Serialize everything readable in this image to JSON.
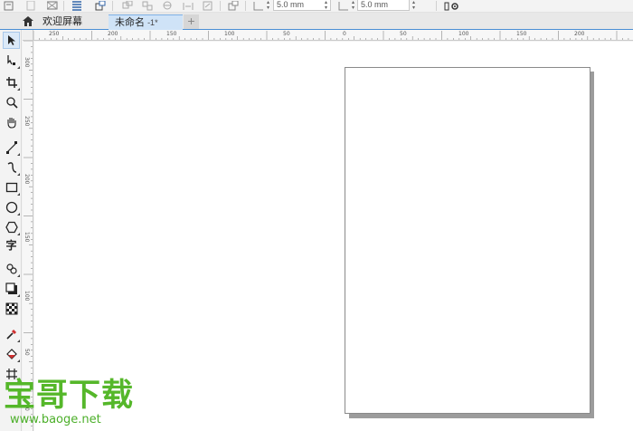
{
  "property_bar": {
    "nudge_x_value": "5.0 mm",
    "nudge_y_value": "5.0 mm"
  },
  "tabs": {
    "welcome_label": "欢迎屏幕",
    "document_label": "未命名",
    "document_suffix": "-1*",
    "add_tab_symbol": "+"
  },
  "toolbox": {
    "text_tool_glyph": "字",
    "items": [
      {
        "name": "pick-tool",
        "icon": "arrow-cursor-icon"
      },
      {
        "name": "shape-tool",
        "icon": "shape-node-icon"
      },
      {
        "name": "crop-tool",
        "icon": "crop-icon"
      },
      {
        "name": "zoom-tool",
        "icon": "magnifier-icon"
      },
      {
        "name": "pan-tool",
        "icon": "hand-icon"
      },
      {
        "name": "freehand-tool",
        "icon": "freehand-line-icon"
      },
      {
        "name": "artistic-media-tool",
        "icon": "curve-icon"
      },
      {
        "name": "rectangle-tool",
        "icon": "rectangle-icon"
      },
      {
        "name": "ellipse-tool",
        "icon": "ellipse-icon"
      },
      {
        "name": "polygon-tool",
        "icon": "polygon-icon"
      },
      {
        "name": "text-tool",
        "icon": "text-icon"
      },
      {
        "name": "parallel-dimension-tool",
        "icon": "dimension-icon"
      },
      {
        "name": "drop-shadow-tool",
        "icon": "shadow-icon"
      },
      {
        "name": "transparency-tool",
        "icon": "checker-icon"
      },
      {
        "name": "eyedropper-tool",
        "icon": "eyedropper-icon"
      },
      {
        "name": "interactive-fill-tool",
        "icon": "paint-bucket-icon"
      },
      {
        "name": "smart-fill-tool",
        "icon": "mesh-icon"
      }
    ]
  },
  "rulers": {
    "horizontal": [
      "250",
      "200",
      "150",
      "100",
      "50",
      "0",
      "50",
      "100",
      "150",
      "200"
    ],
    "vertical": [
      "300",
      "250",
      "200",
      "150",
      "100",
      "50",
      "0"
    ]
  },
  "watermark": {
    "title": "宝哥下载",
    "url": "www.baoge.net"
  },
  "colors": {
    "accent_blue": "#4a8ed4",
    "active_tab": "#cfe3f7",
    "watermark_green": "#55b72a"
  }
}
